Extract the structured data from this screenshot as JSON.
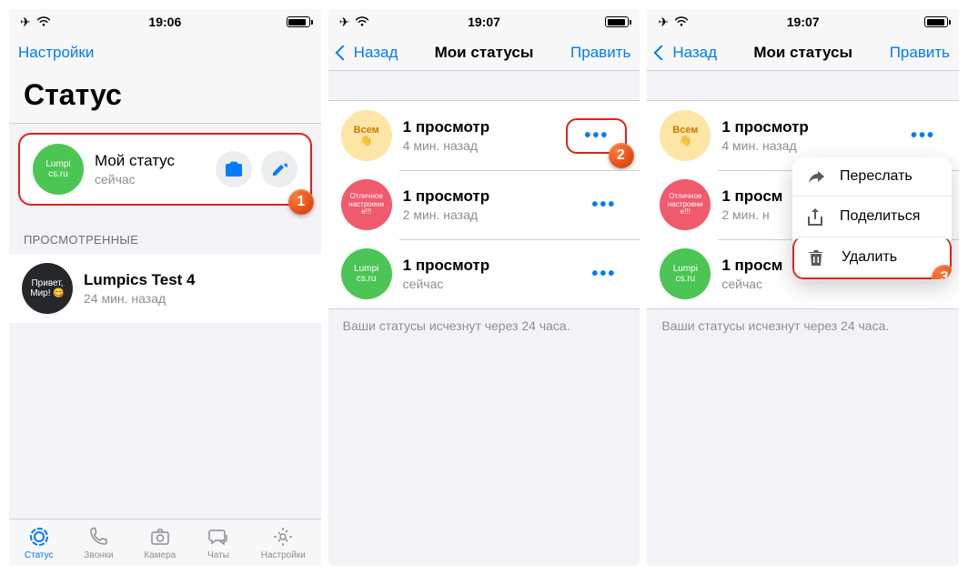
{
  "screen1": {
    "time": "19:06",
    "nav_settings": "Настройки",
    "title": "Статус",
    "my_status": {
      "title": "Мой статус",
      "sub": "сейчас",
      "avatar_text": "Lumpi\ncs.ru"
    },
    "viewed_header": "ПРОСМОТРЕННЫЕ",
    "viewed": [
      {
        "title": "Lumpics Test 4",
        "sub": "24 мин. назад",
        "avatar_text": "Привет,\nМир! 😋"
      }
    ],
    "tabs": {
      "status": "Статус",
      "calls": "Звонки",
      "camera": "Камера",
      "chats": "Чаты",
      "settings": "Настройки"
    }
  },
  "screen2": {
    "time": "19:07",
    "back": "Назад",
    "title": "Мои статусы",
    "edit": "Править",
    "items": [
      {
        "title": "1 просмотр",
        "sub": "4 мин. назад",
        "avatar": "yellow",
        "avatar_text": "Всем\n👋"
      },
      {
        "title": "1 просмотр",
        "sub": "2 мин. назад",
        "avatar": "pink",
        "avatar_text": "Отличное\nнастроени\nе!!!"
      },
      {
        "title": "1 просмотр",
        "sub": "сейчас",
        "avatar": "green",
        "avatar_text": "Lumpi\ncs.ru"
      }
    ],
    "footer": "Ваши статусы исчезнут через 24 часа."
  },
  "screen3": {
    "time": "19:07",
    "back": "Назад",
    "title": "Мои статусы",
    "edit": "Править",
    "items": [
      {
        "title": "1 просмотр",
        "sub": "4 мин. назад",
        "avatar": "yellow",
        "avatar_text": "Всем\n👋"
      },
      {
        "title": "1 просм",
        "sub": "2 мин. н",
        "avatar": "pink",
        "avatar_text": "Отличное\nнастроени\nе!!!"
      },
      {
        "title": "1 просм",
        "sub": "сейчас",
        "avatar": "green",
        "avatar_text": "Lumpi\ncs.ru"
      }
    ],
    "footer": "Ваши статусы исчезнут через 24 часа.",
    "menu": {
      "forward": "Переслать",
      "share": "Поделиться",
      "delete": "Удалить"
    }
  }
}
